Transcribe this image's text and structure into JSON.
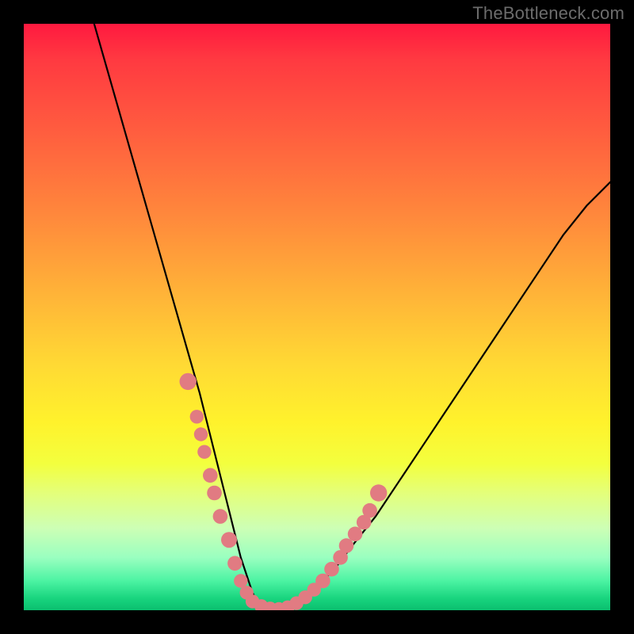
{
  "watermark": "TheBottleneck.com",
  "chart_data": {
    "type": "line",
    "title": "",
    "xlabel": "",
    "ylabel": "",
    "xlim": [
      0,
      100
    ],
    "ylim": [
      0,
      100
    ],
    "grid": false,
    "series": [
      {
        "name": "curve",
        "x": [
          12,
          14,
          16,
          18,
          20,
          22,
          24,
          26,
          28,
          30,
          31,
          32,
          33,
          34,
          35,
          36,
          37,
          38,
          39,
          40,
          42,
          44,
          46,
          48,
          50,
          53,
          56,
          60,
          64,
          68,
          72,
          76,
          80,
          84,
          88,
          92,
          96,
          100
        ],
        "y": [
          100,
          93,
          86,
          79,
          72,
          65,
          58,
          51,
          44,
          37,
          33,
          29,
          25,
          21,
          17,
          13,
          9,
          6,
          3,
          1,
          0,
          0,
          1,
          2,
          4,
          7,
          11,
          16,
          22,
          28,
          34,
          40,
          46,
          52,
          58,
          64,
          69,
          73
        ]
      }
    ],
    "scatter_points": {
      "name": "marker-dots",
      "color": "#e17b82",
      "points": [
        {
          "x": 28.0,
          "y": 39,
          "r": 1.6
        },
        {
          "x": 29.5,
          "y": 33,
          "r": 1.3
        },
        {
          "x": 30.2,
          "y": 30,
          "r": 1.3
        },
        {
          "x": 30.8,
          "y": 27,
          "r": 1.3
        },
        {
          "x": 31.8,
          "y": 23,
          "r": 1.4
        },
        {
          "x": 32.5,
          "y": 20,
          "r": 1.4
        },
        {
          "x": 33.5,
          "y": 16,
          "r": 1.4
        },
        {
          "x": 35.0,
          "y": 12,
          "r": 1.5
        },
        {
          "x": 36.0,
          "y": 8,
          "r": 1.4
        },
        {
          "x": 37.0,
          "y": 5,
          "r": 1.3
        },
        {
          "x": 38.0,
          "y": 3,
          "r": 1.3
        },
        {
          "x": 39.0,
          "y": 1.5,
          "r": 1.3
        },
        {
          "x": 40.5,
          "y": 0.7,
          "r": 1.3
        },
        {
          "x": 42.0,
          "y": 0.3,
          "r": 1.3
        },
        {
          "x": 43.5,
          "y": 0.2,
          "r": 1.3
        },
        {
          "x": 45.0,
          "y": 0.5,
          "r": 1.3
        },
        {
          "x": 46.5,
          "y": 1.2,
          "r": 1.3
        },
        {
          "x": 48.0,
          "y": 2.2,
          "r": 1.3
        },
        {
          "x": 49.5,
          "y": 3.5,
          "r": 1.3
        },
        {
          "x": 51.0,
          "y": 5.0,
          "r": 1.4
        },
        {
          "x": 52.5,
          "y": 7.0,
          "r": 1.4
        },
        {
          "x": 54.0,
          "y": 9.0,
          "r": 1.4
        },
        {
          "x": 55.0,
          "y": 11,
          "r": 1.4
        },
        {
          "x": 56.5,
          "y": 13,
          "r": 1.4
        },
        {
          "x": 58.0,
          "y": 15,
          "r": 1.4
        },
        {
          "x": 59.0,
          "y": 17,
          "r": 1.4
        },
        {
          "x": 60.5,
          "y": 20,
          "r": 1.6
        }
      ]
    }
  }
}
